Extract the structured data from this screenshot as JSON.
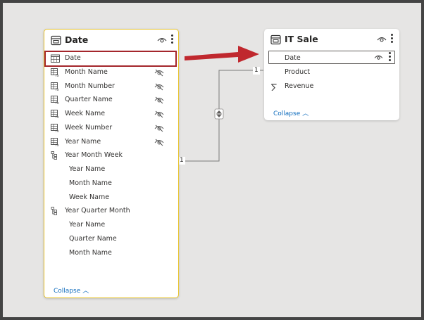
{
  "colors": {
    "canvas": "#e6e5e4",
    "frame": "#444444",
    "selected_border": "#e8c32d",
    "highlight": "#a4262c",
    "arrow": "#c0282e",
    "link": "#0f6cbd"
  },
  "date_table": {
    "title": "Date",
    "fields": [
      {
        "label": "Date",
        "icon": "calendar-icon",
        "hidden": false
      },
      {
        "label": "Month Name",
        "icon": "calculated-column-icon",
        "hidden": true
      },
      {
        "label": "Month Number",
        "icon": "calculated-column-icon",
        "hidden": true
      },
      {
        "label": "Quarter Name",
        "icon": "calculated-column-icon",
        "hidden": true
      },
      {
        "label": "Week Name",
        "icon": "calculated-column-icon",
        "hidden": true
      },
      {
        "label": "Week Number",
        "icon": "calculated-column-icon",
        "hidden": true
      },
      {
        "label": "Year Name",
        "icon": "calculated-column-icon",
        "hidden": true
      },
      {
        "label": "Year Month Week",
        "icon": "hierarchy-icon",
        "hidden": false
      },
      {
        "label": "Year Name",
        "icon": "",
        "hidden": false
      },
      {
        "label": "Month Name",
        "icon": "",
        "hidden": false
      },
      {
        "label": "Week Name",
        "icon": "",
        "hidden": false
      },
      {
        "label": "Year Quarter Month",
        "icon": "hierarchy-icon",
        "hidden": false
      },
      {
        "label": "Year Name",
        "icon": "",
        "hidden": false
      },
      {
        "label": "Quarter Name",
        "icon": "",
        "hidden": false
      },
      {
        "label": "Month Name",
        "icon": "",
        "hidden": false
      }
    ],
    "collapse_label": "Collapse"
  },
  "sale_table": {
    "title": "IT Sale",
    "fields": [
      {
        "label": "Date",
        "icon": "",
        "hidden": false
      },
      {
        "label": "Product",
        "icon": "",
        "hidden": false
      },
      {
        "label": "Revenue",
        "icon": "sigma-icon",
        "hidden": false
      }
    ],
    "collapse_label": "Collapse"
  },
  "relationship": {
    "from_cardinality": "1",
    "to_cardinality": "1"
  }
}
